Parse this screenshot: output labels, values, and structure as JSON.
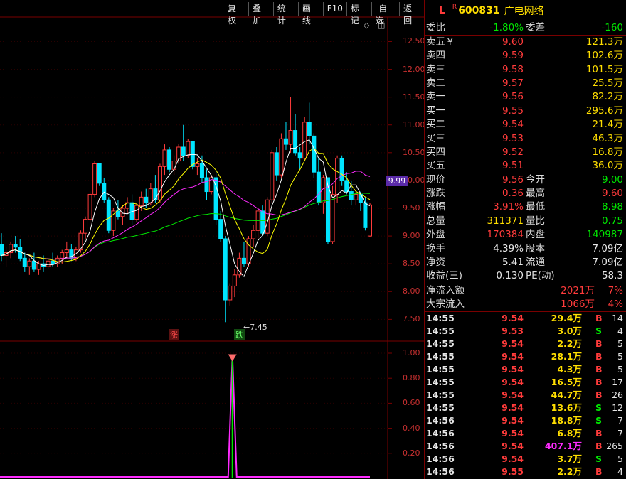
{
  "toolbar": [
    "复权",
    "叠加",
    "统计",
    "画线",
    "F10",
    "标记",
    "-自选",
    "返回"
  ],
  "corner_icons": "◇ ◫",
  "price_axis": [
    "12.50",
    "12.00",
    "11.50",
    "11.00",
    "10.50",
    "10.00",
    "9.50",
    "9.00",
    "8.50",
    "8.00",
    "7.50"
  ],
  "indicator_axis": [
    "1.00",
    "0.80",
    "0.60",
    "0.40",
    "0.20"
  ],
  "current_price_tag": "9.99",
  "min_label": "←7.45",
  "tags": {
    "zhang": "涨",
    "die": "跌"
  },
  "header": {
    "l": "L",
    "r": "R",
    "code": "600831",
    "name": "广电网络"
  },
  "weibi": {
    "label": "委比",
    "value": "-1.80%",
    "label2": "委差",
    "value2": "-160"
  },
  "sell": [
    {
      "label": "卖五￥",
      "price": "9.60",
      "vol": "121.3万"
    },
    {
      "label": "卖四",
      "price": "9.59",
      "vol": "102.6万"
    },
    {
      "label": "卖三",
      "price": "9.58",
      "vol": "101.5万"
    },
    {
      "label": "卖二",
      "price": "9.57",
      "vol": "25.5万"
    },
    {
      "label": "卖一",
      "price": "9.56",
      "vol": "82.2万"
    }
  ],
  "buy": [
    {
      "label": "买一",
      "price": "9.55",
      "vol": "295.6万"
    },
    {
      "label": "买二",
      "price": "9.54",
      "vol": "21.4万"
    },
    {
      "label": "买三",
      "price": "9.53",
      "vol": "46.3万"
    },
    {
      "label": "买四",
      "price": "9.52",
      "vol": "16.8万"
    },
    {
      "label": "买五",
      "price": "9.51",
      "vol": "36.0万"
    }
  ],
  "quote": [
    {
      "l1": "现价",
      "v1": "9.56",
      "c1": "red",
      "l2": "今开",
      "v2": "9.00",
      "c2": "green"
    },
    {
      "l1": "涨跌",
      "v1": "0.36",
      "c1": "red",
      "l2": "最高",
      "v2": "9.60",
      "c2": "red"
    },
    {
      "l1": "涨幅",
      "v1": "3.91%",
      "c1": "red",
      "l2": "最低",
      "v2": "8.98",
      "c2": "green"
    },
    {
      "l1": "总量",
      "v1": "311371",
      "c1": "yellow",
      "l2": "量比",
      "v2": "0.75",
      "c2": "green"
    },
    {
      "l1": "外盘",
      "v1": "170384",
      "c1": "red",
      "l2": "内盘",
      "v2": "140987",
      "c2": "green"
    }
  ],
  "finance": [
    {
      "l1": "换手",
      "v1": "4.39%",
      "l2": "股本",
      "v2": "7.09亿"
    },
    {
      "l1": "净资",
      "v1": "5.41",
      "l2": "流通",
      "v2": "7.09亿"
    },
    {
      "l1": "收益(三)",
      "v1": "0.130",
      "l2": "PE(动)",
      "v2": "58.3"
    }
  ],
  "flow": [
    {
      "label": "净流入额",
      "value": "2021万",
      "pct": "7%"
    },
    {
      "label": "大宗流入",
      "value": "1066万",
      "pct": "4%"
    }
  ],
  "trades": [
    {
      "time": "14:55",
      "price": "9.54",
      "vol": "29.4万",
      "bs": "B",
      "n": "14"
    },
    {
      "time": "14:55",
      "price": "9.53",
      "vol": "3.0万",
      "bs": "S",
      "n": "4"
    },
    {
      "time": "14:55",
      "price": "9.54",
      "vol": "2.2万",
      "bs": "B",
      "n": "5"
    },
    {
      "time": "14:55",
      "price": "9.54",
      "vol": "28.1万",
      "bs": "B",
      "n": "5"
    },
    {
      "time": "14:55",
      "price": "9.54",
      "vol": "4.3万",
      "bs": "B",
      "n": "5"
    },
    {
      "time": "14:55",
      "price": "9.54",
      "vol": "16.5万",
      "bs": "B",
      "n": "17"
    },
    {
      "time": "14:55",
      "price": "9.54",
      "vol": "44.7万",
      "bs": "B",
      "n": "26"
    },
    {
      "time": "14:55",
      "price": "9.54",
      "vol": "13.6万",
      "bs": "S",
      "n": "12"
    },
    {
      "time": "14:56",
      "price": "9.54",
      "vol": "18.8万",
      "bs": "S",
      "n": "7"
    },
    {
      "time": "14:56",
      "price": "9.54",
      "vol": "6.8万",
      "bs": "B",
      "n": "7"
    },
    {
      "time": "14:56",
      "price": "9.54",
      "vol": "407.1万",
      "bs": "B",
      "n": "265",
      "big": true
    },
    {
      "time": "14:56",
      "price": "9.54",
      "vol": "3.7万",
      "bs": "S",
      "n": "5"
    },
    {
      "time": "14:56",
      "price": "9.55",
      "vol": "2.2万",
      "bs": "B",
      "n": "4"
    }
  ],
  "colors": {
    "up": "#ff3b3b",
    "down": "#00e5ff",
    "ma5": "#ffffff",
    "ma10": "#ffff00",
    "ma20": "#ff2bff",
    "ma60": "#00e600",
    "grid": "#7a0000"
  },
  "chart_data": {
    "type": "candlestick",
    "ylim": [
      7.3,
      12.8
    ],
    "candles": [
      [
        8.85,
        9.05,
        8.55,
        8.65
      ],
      [
        8.65,
        8.8,
        8.45,
        8.7
      ],
      [
        8.7,
        8.9,
        8.6,
        8.85
      ],
      [
        8.85,
        9.0,
        8.7,
        8.8
      ],
      [
        8.8,
        8.95,
        8.55,
        8.6
      ],
      [
        8.6,
        8.7,
        8.35,
        8.45
      ],
      [
        8.45,
        8.6,
        8.3,
        8.55
      ],
      [
        8.55,
        8.7,
        8.35,
        8.4
      ],
      [
        8.4,
        8.55,
        8.3,
        8.5
      ],
      [
        8.5,
        8.65,
        8.35,
        8.45
      ],
      [
        8.45,
        8.6,
        8.4,
        8.55
      ],
      [
        8.55,
        8.7,
        8.45,
        8.5
      ],
      [
        8.5,
        8.65,
        8.45,
        8.6
      ],
      [
        8.6,
        8.75,
        8.5,
        8.7
      ],
      [
        8.7,
        8.9,
        8.6,
        8.75
      ],
      [
        8.75,
        8.85,
        8.55,
        8.6
      ],
      [
        8.6,
        8.8,
        8.55,
        8.75
      ],
      [
        8.75,
        9.1,
        8.7,
        9.05
      ],
      [
        9.05,
        9.35,
        8.95,
        9.3
      ],
      [
        9.3,
        9.8,
        9.2,
        9.75
      ],
      [
        9.75,
        10.35,
        9.7,
        10.3
      ],
      [
        10.3,
        10.3,
        9.9,
        9.95
      ],
      [
        9.95,
        10.05,
        9.6,
        9.65
      ],
      [
        9.65,
        9.7,
        9.05,
        9.1
      ],
      [
        9.1,
        9.5,
        9.0,
        9.45
      ],
      [
        9.45,
        9.65,
        9.3,
        9.35
      ],
      [
        9.35,
        9.55,
        9.2,
        9.5
      ],
      [
        9.5,
        9.7,
        9.4,
        9.6
      ],
      [
        9.6,
        9.75,
        9.2,
        9.3
      ],
      [
        9.3,
        9.6,
        9.25,
        9.55
      ],
      [
        9.55,
        9.8,
        9.45,
        9.7
      ],
      [
        9.7,
        9.85,
        9.5,
        9.6
      ],
      [
        9.6,
        9.95,
        9.55,
        9.85
      ],
      [
        9.85,
        10.1,
        9.6,
        9.65
      ],
      [
        9.65,
        10.3,
        9.6,
        10.25
      ],
      [
        10.25,
        10.65,
        10.1,
        10.55
      ],
      [
        10.55,
        10.6,
        10.15,
        10.2
      ],
      [
        10.2,
        10.45,
        10.1,
        10.35
      ],
      [
        10.35,
        10.65,
        10.3,
        10.6
      ],
      [
        10.6,
        11.0,
        10.35,
        10.45
      ],
      [
        10.45,
        10.75,
        10.4,
        10.7
      ],
      [
        10.7,
        10.7,
        10.2,
        10.25
      ],
      [
        10.25,
        10.4,
        10.1,
        10.3
      ],
      [
        10.3,
        10.45,
        9.95,
        10.05
      ],
      [
        10.05,
        10.2,
        9.65,
        9.8
      ],
      [
        9.8,
        10.1,
        9.75,
        10.05
      ],
      [
        10.05,
        10.15,
        9.2,
        9.3
      ],
      [
        9.3,
        9.45,
        8.9,
        8.95
      ],
      [
        8.95,
        9.0,
        7.45,
        7.85
      ],
      [
        7.85,
        8.15,
        7.75,
        8.1
      ],
      [
        8.1,
        8.4,
        7.9,
        8.3
      ],
      [
        8.3,
        8.7,
        8.25,
        8.6
      ],
      [
        8.6,
        8.9,
        8.45,
        8.5
      ],
      [
        8.5,
        9.0,
        8.45,
        8.95
      ],
      [
        8.95,
        9.2,
        8.8,
        9.1
      ],
      [
        9.1,
        9.5,
        8.95,
        9.45
      ],
      [
        9.45,
        9.55,
        9.0,
        9.05
      ],
      [
        9.05,
        9.7,
        9.0,
        9.65
      ],
      [
        9.65,
        10.55,
        9.6,
        10.5
      ],
      [
        10.5,
        10.6,
        10.0,
        10.1
      ],
      [
        10.1,
        10.85,
        10.05,
        10.75
      ],
      [
        10.75,
        11.05,
        10.55,
        10.65
      ],
      [
        10.65,
        11.5,
        10.5,
        10.9
      ],
      [
        10.9,
        11.2,
        10.45,
        10.5
      ],
      [
        10.5,
        10.6,
        10.2,
        10.4
      ],
      [
        10.4,
        11.15,
        10.35,
        11.05
      ],
      [
        11.05,
        11.4,
        10.65,
        10.8
      ],
      [
        10.8,
        10.85,
        10.05,
        10.15
      ],
      [
        10.15,
        10.4,
        9.55,
        9.6
      ],
      [
        9.6,
        10.1,
        9.4,
        10.05
      ],
      [
        10.05,
        10.05,
        8.85,
        8.9
      ],
      [
        8.9,
        9.9,
        8.85,
        9.75
      ],
      [
        9.75,
        10.45,
        9.6,
        10.4
      ],
      [
        10.4,
        10.45,
        9.9,
        10.0
      ],
      [
        10.0,
        10.15,
        9.75,
        9.8
      ],
      [
        9.8,
        10.0,
        9.55,
        9.65
      ],
      [
        9.65,
        9.8,
        9.55,
        9.75
      ],
      [
        9.75,
        9.8,
        9.45,
        9.6
      ],
      [
        9.6,
        9.7,
        9.1,
        9.15
      ],
      [
        9.0,
        9.6,
        8.98,
        9.56
      ]
    ]
  }
}
